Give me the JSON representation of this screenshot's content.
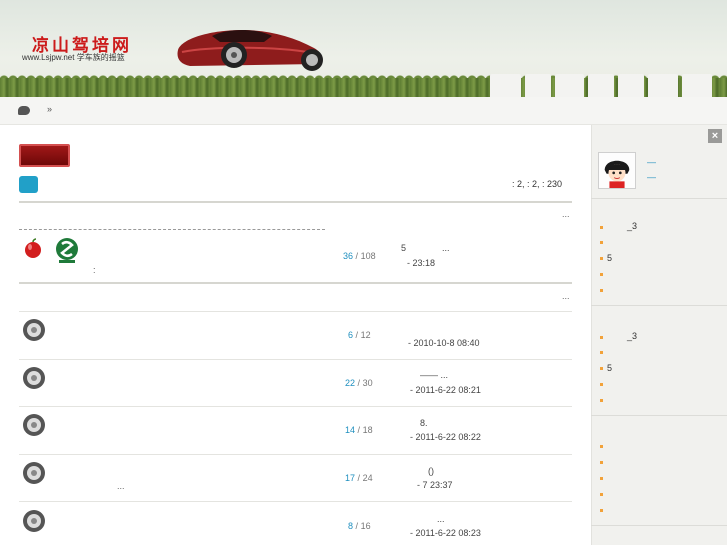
{
  "header": {
    "logo_title": "凉山驾培网",
    "logo_subtitle": "www.Lsjpw.net 学车族的摇篮",
    "colors": {
      "brand_red": "#cc1b1b",
      "accent_blue": "#1f8fbf",
      "bullet_orange": "#f2a23a"
    }
  },
  "breadcrumb": {
    "separator": "»"
  },
  "forum": {
    "stats": ": 2,  : 2,  : 230",
    "colon": ":",
    "section_more_1": "...",
    "section_more_2": "..."
  },
  "pinned": {
    "replies": "36",
    "views": "108",
    "last_line1": "5",
    "last_line1_more": "...",
    "last_line2": "-   23:18"
  },
  "threads": [
    {
      "replies": "6",
      "views": "12",
      "title_fragment": "",
      "title_more": "",
      "last_line1": "",
      "last_line2": "- 2010-10-8 08:40"
    },
    {
      "replies": "22",
      "views": "30",
      "title_fragment": "",
      "title_more": "",
      "last_line1": "——   ...",
      "last_line2": "- 2011-6-22 08:21"
    },
    {
      "replies": "14",
      "views": "18",
      "title_fragment": "",
      "title_more": "",
      "last_line1": "8.",
      "last_line2": "- 2011-6-22 08:22"
    },
    {
      "replies": "17",
      "views": "24",
      "title_fragment": "",
      "title_more": "...",
      "last_line1": "()",
      "last_line2": "- 7   23:37"
    },
    {
      "replies": "8",
      "views": "16",
      "title_fragment": "",
      "title_more": "",
      "last_line1": "...",
      "last_line2": "- 2011-6-22 08:23"
    }
  ],
  "count_separator": "/",
  "sidebar": {
    "close_label": "×",
    "user_link_1": "—",
    "user_link_2": "—",
    "box1": {
      "line1": "_3",
      "line2": "5"
    },
    "box2": {
      "line1": "_3",
      "line2": "5"
    }
  }
}
